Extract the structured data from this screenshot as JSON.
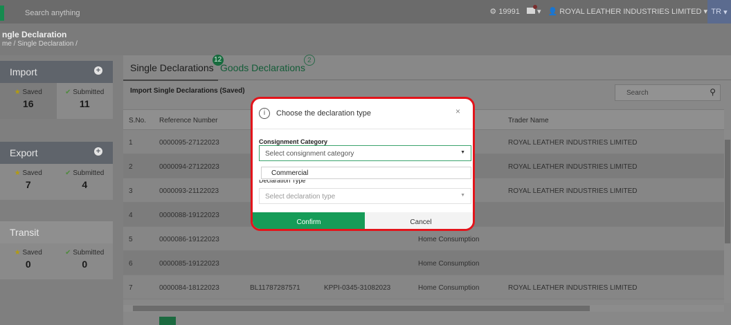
{
  "topbar": {
    "search_placeholder": "Search anything",
    "notification_count": "19991",
    "company_menu": "ROYAL LEATHER INDUSTRIES LIMITED",
    "lang": "TR"
  },
  "page": {
    "title": "ngle Declaration",
    "breadcrumb": "me / Single Declaration /"
  },
  "cards": [
    {
      "title": "Import",
      "saved_label": "Saved",
      "saved": "16",
      "submitted_label": "Submitted",
      "submitted": "11"
    },
    {
      "title": "Export",
      "saved_label": "Saved",
      "saved": "7",
      "submitted_label": "Submitted",
      "submitted": "4"
    },
    {
      "title": "Transit",
      "saved_label": "Saved",
      "saved": "0",
      "submitted_label": "Submitted",
      "submitted": "0"
    }
  ],
  "tabs": {
    "single": {
      "label": "Single Declarations",
      "badge": "12"
    },
    "goods": {
      "label": "Goods Declarations",
      "badge": "2"
    }
  },
  "section_title": "Import Single Declarations (Saved)",
  "table_search_placeholder": "Search",
  "table": {
    "headers": [
      "S.No.",
      "Reference Number",
      "Trader Name"
    ],
    "rows": [
      {
        "sno": "1",
        "ref": "0000095-27122023",
        "bl": "",
        "kppi": "",
        "type": "",
        "trader": "ROYAL LEATHER INDUSTRIES LIMITED"
      },
      {
        "sno": "2",
        "ref": "0000094-27122023",
        "bl": "",
        "kppi": "",
        "type": "",
        "trader": "ROYAL LEATHER INDUSTRIES LIMITED"
      },
      {
        "sno": "3",
        "ref": "0000093-21122023",
        "bl": "",
        "kppi": "",
        "type": "",
        "trader": "ROYAL LEATHER INDUSTRIES LIMITED"
      },
      {
        "sno": "4",
        "ref": "0000088-19122023",
        "bl": "",
        "kppi": "",
        "type": "",
        "trader": ""
      },
      {
        "sno": "5",
        "ref": "0000086-19122023",
        "bl": "",
        "kppi": "",
        "type": "Home Consumption",
        "trader": ""
      },
      {
        "sno": "6",
        "ref": "0000085-19122023",
        "bl": "",
        "kppi": "",
        "type": "Home Consumption",
        "trader": ""
      },
      {
        "sno": "7",
        "ref": "0000084-18122023",
        "bl": "BL11787287571",
        "kppi": "KPPI-0345-31082023",
        "type": "Home Consumption",
        "trader": "ROYAL LEATHER INDUSTRIES LIMITED"
      }
    ]
  },
  "modal": {
    "title": "Choose the declaration type",
    "consignment_label": "Consignment Category",
    "consignment_placeholder": "Select consignment category",
    "option_commercial": "Commercial",
    "declaration_label": "Declaration Type",
    "declaration_placeholder": "Select declaration type",
    "confirm": "Confirm",
    "cancel": "Cancel"
  },
  "colors": {
    "accent_green": "#169c58",
    "highlight_red": "#e3141b"
  }
}
